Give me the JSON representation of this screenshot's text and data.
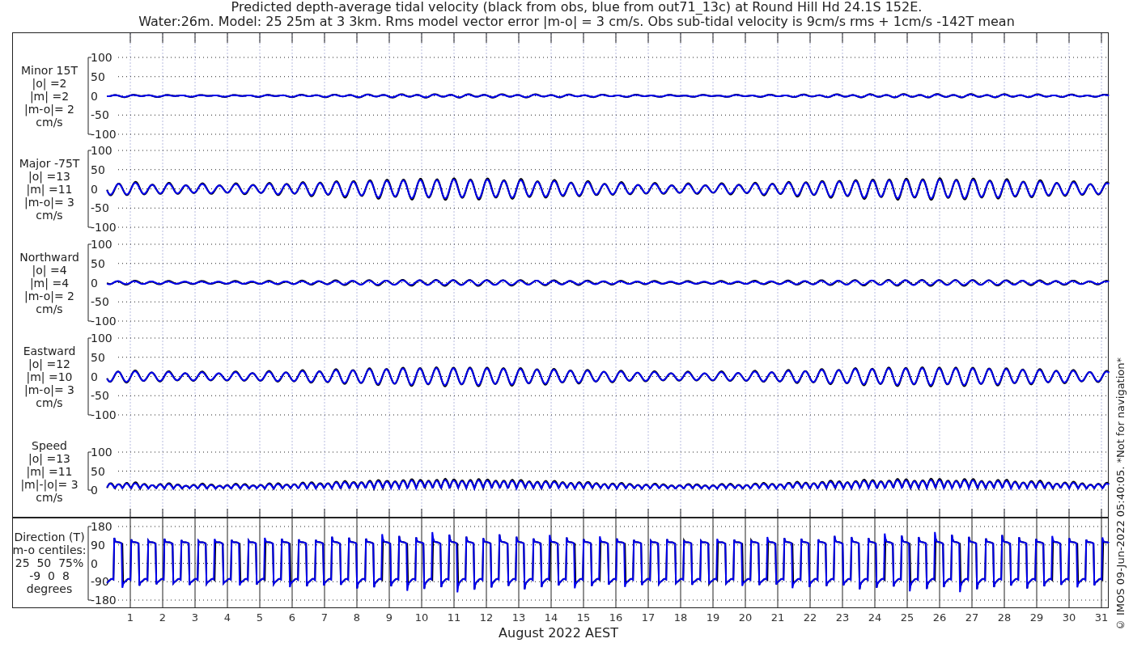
{
  "title_lines": [
    "Predicted depth-average tidal velocity (black from obs, blue from out71_13c) at Round Hill Hd 24.1S 152E.",
    "Water:26m. Model: 25 25m at 3 3km. Rms model vector error |m-o| = 3 cm/s. Obs sub-tidal velocity is 9cm/s rms + 1cm/s -142T mean"
  ],
  "panels": [
    {
      "kind": "minor",
      "label_lines": [
        "Minor 15T",
        "|o| =2",
        "|m| =2",
        "|m-o|= 2",
        "cm/s"
      ],
      "yticks": [
        "100",
        "50",
        "0",
        "-50",
        "-100"
      ]
    },
    {
      "kind": "major",
      "label_lines": [
        "Major -75T",
        "|o| =13",
        "|m| =11",
        "|m-o|= 3",
        "cm/s"
      ],
      "yticks": [
        "100",
        "50",
        "0",
        "-50",
        "-100"
      ]
    },
    {
      "kind": "north",
      "label_lines": [
        "Northward",
        "|o| =4",
        "|m| =4",
        "|m-o|= 2",
        "cm/s"
      ],
      "yticks": [
        "100",
        "50",
        "0",
        "-50",
        "-100"
      ]
    },
    {
      "kind": "east",
      "label_lines": [
        "Eastward",
        "|o| =12",
        "|m| =10",
        "|m-o|= 3",
        "cm/s"
      ],
      "yticks": [
        "100",
        "50",
        "0",
        "-50",
        "-100"
      ]
    },
    {
      "kind": "speed",
      "label_lines": [
        "Speed",
        "|o| =13",
        "|m| =11",
        "|m|-|o|= 3",
        "cm/s"
      ],
      "yticks": [
        "100",
        "50",
        "0"
      ]
    }
  ],
  "direction_panel": {
    "kind": "direction",
    "label_lines": [
      "Direction (T)",
      "m-o centiles:",
      "25  50  75%",
      "-9  0  8",
      "degrees"
    ],
    "yticks": [
      "180",
      "90",
      "0",
      "-90",
      "-180"
    ]
  },
  "x_axis": {
    "day_labels": [
      "1",
      "2",
      "3",
      "4",
      "5",
      "6",
      "7",
      "8",
      "9",
      "10",
      "11",
      "12",
      "13",
      "14",
      "15",
      "16",
      "17",
      "18",
      "19",
      "20",
      "21",
      "22",
      "23",
      "24",
      "25",
      "26",
      "27",
      "28",
      "29",
      "30",
      "31"
    ],
    "label": "August 2022 AEST"
  },
  "credit": "© IMOS 09-Jun-2022 05:40:05. *Not for navigation*"
}
